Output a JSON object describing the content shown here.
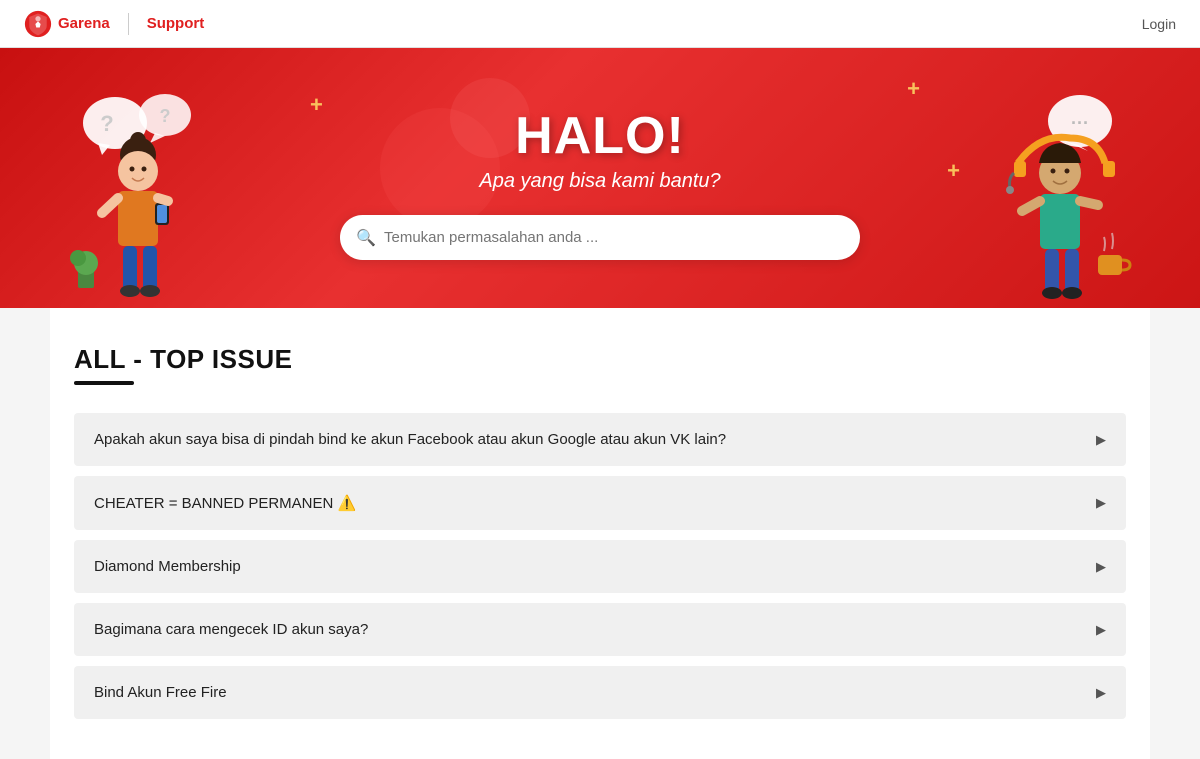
{
  "navbar": {
    "brand": "Garena",
    "divider": "|",
    "support": "Support",
    "login_label": "Login"
  },
  "hero": {
    "title": "HALO!",
    "subtitle": "Apa yang bisa kami bantu?",
    "search_placeholder": "Temukan permasalahan anda ..."
  },
  "section": {
    "title": "ALL - TOP ISSUE"
  },
  "faq_items": [
    {
      "id": 1,
      "text": "Apakah akun saya bisa di pindah bind ke akun Facebook atau akun Google atau akun VK lain?"
    },
    {
      "id": 2,
      "text": "CHEATER = BANNED PERMANEN ⚠️"
    },
    {
      "id": 3,
      "text": "Diamond Membership"
    },
    {
      "id": 4,
      "text": "Bagimana cara mengecek ID akun saya?"
    },
    {
      "id": 5,
      "text": "Bind Akun Free Fire"
    }
  ],
  "icons": {
    "search": "🔍",
    "arrow_right": "▶",
    "question": "?",
    "dots": "···"
  }
}
